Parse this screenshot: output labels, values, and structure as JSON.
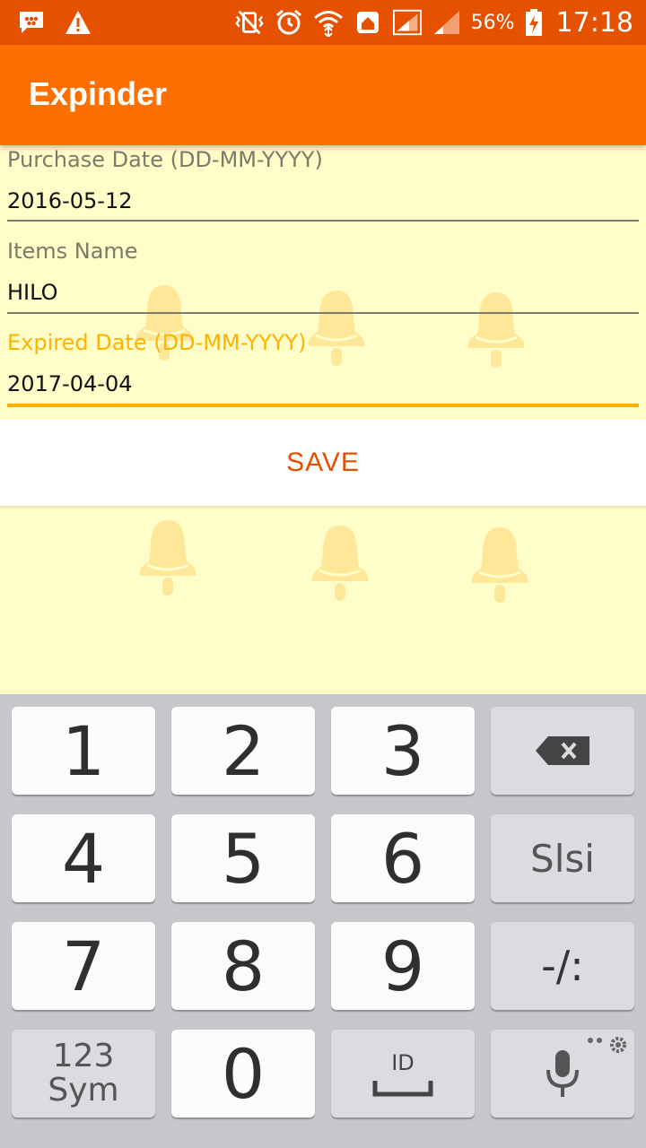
{
  "status_bar": {
    "battery_percent": "56%",
    "time": "17:18",
    "background": "#E65100",
    "icons": [
      "bbm-icon",
      "warning-icon",
      "vibrate-icon",
      "alarm-icon",
      "wifi-icon",
      "home-icon",
      "signal-icon",
      "signal-icon-2",
      "battery-charging-icon"
    ]
  },
  "app_bar": {
    "title": "Expinder",
    "color": "#FF6F00"
  },
  "form": {
    "purchase_date": {
      "label": "Purchase Date (DD-MM-YYYY)",
      "value": "2016-05-12"
    },
    "items_name": {
      "label": "Items Name",
      "value": "HILO"
    },
    "expired_date": {
      "label": "Expired Date (DD-MM-YYYY)",
      "value": "2017-04-04",
      "focused": true,
      "accent": "#FFB300"
    }
  },
  "save_button": {
    "label": "SAVE",
    "color": "#E65100"
  },
  "keyboard": {
    "keys": {
      "one": "1",
      "two": "2",
      "three": "3",
      "four": "4",
      "five": "5",
      "six": "6",
      "seven": "7",
      "eight": "8",
      "nine": "9",
      "zero": "0",
      "language": "Slsi",
      "punct": "-/:",
      "sym_top": "123",
      "sym_bottom": "Sym",
      "space_locale": "ID"
    },
    "icons": [
      "backspace-icon",
      "space-icon",
      "microphone-icon",
      "settings-icon"
    ]
  }
}
